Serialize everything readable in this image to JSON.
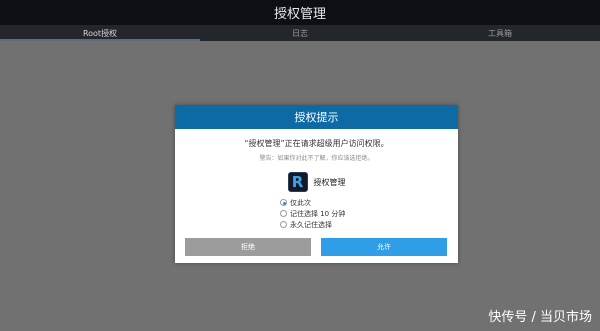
{
  "topbar": {
    "title": "授权管理"
  },
  "tabs": [
    {
      "label": "Root授权",
      "active": true
    },
    {
      "label": "日志",
      "active": false
    },
    {
      "label": "工具箱",
      "active": false
    }
  ],
  "dialog": {
    "title": "授权提示",
    "message": "“授权管理”正在请求超级用户访问权限。",
    "warning": "警告：如果你对此不了解，你应该选拒绝。",
    "app_icon_letter": "R",
    "app_name": "授权管理",
    "options": [
      {
        "label": "仅此次",
        "selected": true
      },
      {
        "label": "记住选择 10 分钟",
        "selected": false
      },
      {
        "label": "永久记住选择",
        "selected": false
      }
    ],
    "deny_label": "拒绝",
    "allow_label": "允许"
  },
  "colors": {
    "dialog_header": "#0d6aa5",
    "allow_button": "#2f9ee6",
    "deny_button": "#9c9c9c"
  },
  "watermark": "快传号 / 当贝市场"
}
